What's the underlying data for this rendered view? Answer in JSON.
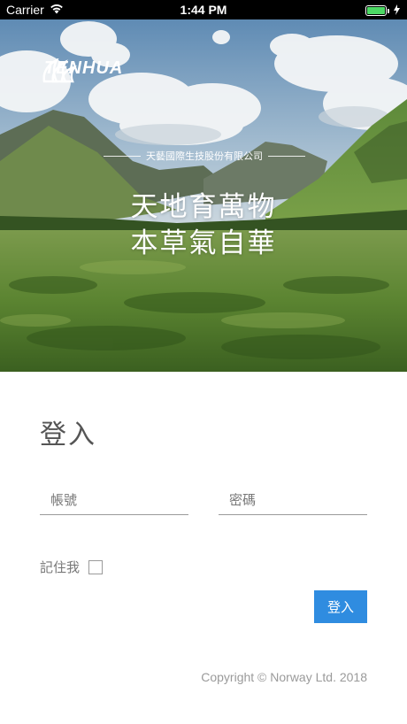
{
  "status_bar": {
    "carrier": "Carrier",
    "time": "1:44 PM",
    "battery_color": "#4cd964"
  },
  "hero": {
    "logo_text": "TENHUA",
    "company_name": "天藝國際生技股份有限公司",
    "slogan_line1": "天地育萬物",
    "slogan_line2": "本草氣自華"
  },
  "login": {
    "title": "登入",
    "account_placeholder": "帳號",
    "password_placeholder": "密碼",
    "remember_label": "記住我",
    "remember_checked": false,
    "button_label": "登入",
    "button_color": "#2f8ce0"
  },
  "footer": {
    "copyright": "Copyright © Norway Ltd. 2018"
  }
}
